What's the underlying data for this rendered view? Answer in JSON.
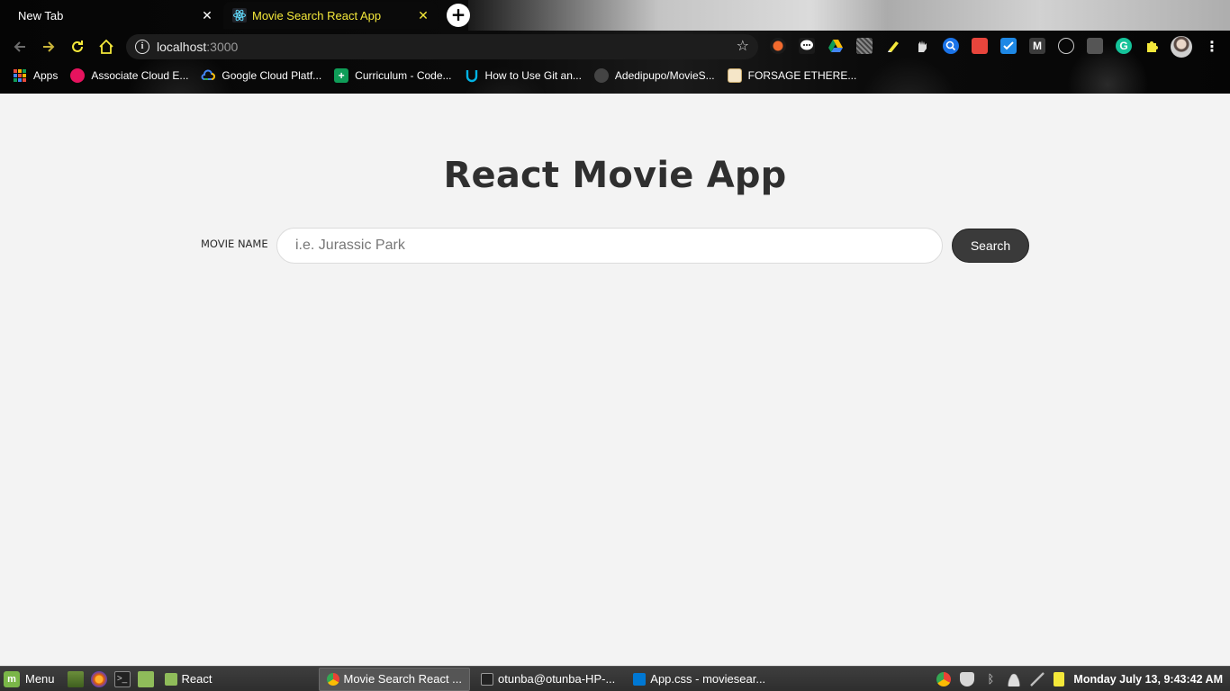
{
  "browser": {
    "tabs": [
      {
        "title": "New Tab",
        "active": false
      },
      {
        "title": "Movie Search React App",
        "active": true
      }
    ],
    "new_tab_symbol": "+",
    "address": {
      "host": "localhost",
      "port": ":3000"
    },
    "bookmarks": [
      {
        "label": "Apps",
        "icon": "apps-grid-icon",
        "color": "#e84c3d"
      },
      {
        "label": "Associate Cloud E...",
        "icon": "pluralsight-icon",
        "color": "#e6135e"
      },
      {
        "label": "Google Cloud Platf...",
        "icon": "google-cloud-icon",
        "color": "#4285f4"
      },
      {
        "label": "Curriculum - Code...",
        "icon": "sheet-plus-icon",
        "color": "#0f9d58"
      },
      {
        "label": "How to Use Git an...",
        "icon": "udacity-icon",
        "color": "#02b3e4"
      },
      {
        "label": "Adedipupo/MovieS...",
        "icon": "github-icon",
        "color": "#444444"
      },
      {
        "label": "FORSAGE ETHERE...",
        "icon": "forsage-icon",
        "color": "#f5e6c8"
      }
    ]
  },
  "page": {
    "title": "React Movie App",
    "form": {
      "label": "MOVIE NAME",
      "input_placeholder": "i.e. Jurassic Park",
      "input_value": "",
      "button_label": "Search"
    }
  },
  "taskbar": {
    "menu_label": "Menu",
    "windows": [
      {
        "label": "React",
        "icon": "folder-icon",
        "active": false
      },
      {
        "label": "Movie Search React ...",
        "icon": "chrome-icon",
        "active": true
      },
      {
        "label": "otunba@otunba-HP-...",
        "icon": "terminal-icon",
        "active": false
      },
      {
        "label": "App.css - moviesear...",
        "icon": "vscode-icon",
        "active": false
      }
    ],
    "clock": "Monday July 13,  9:43:42 AM"
  },
  "colors": {
    "active_tab_text": "#f4e83a",
    "page_background": "#f3f3f3",
    "title_color": "#2f2f2f",
    "button_background": "#3a3a3a"
  }
}
